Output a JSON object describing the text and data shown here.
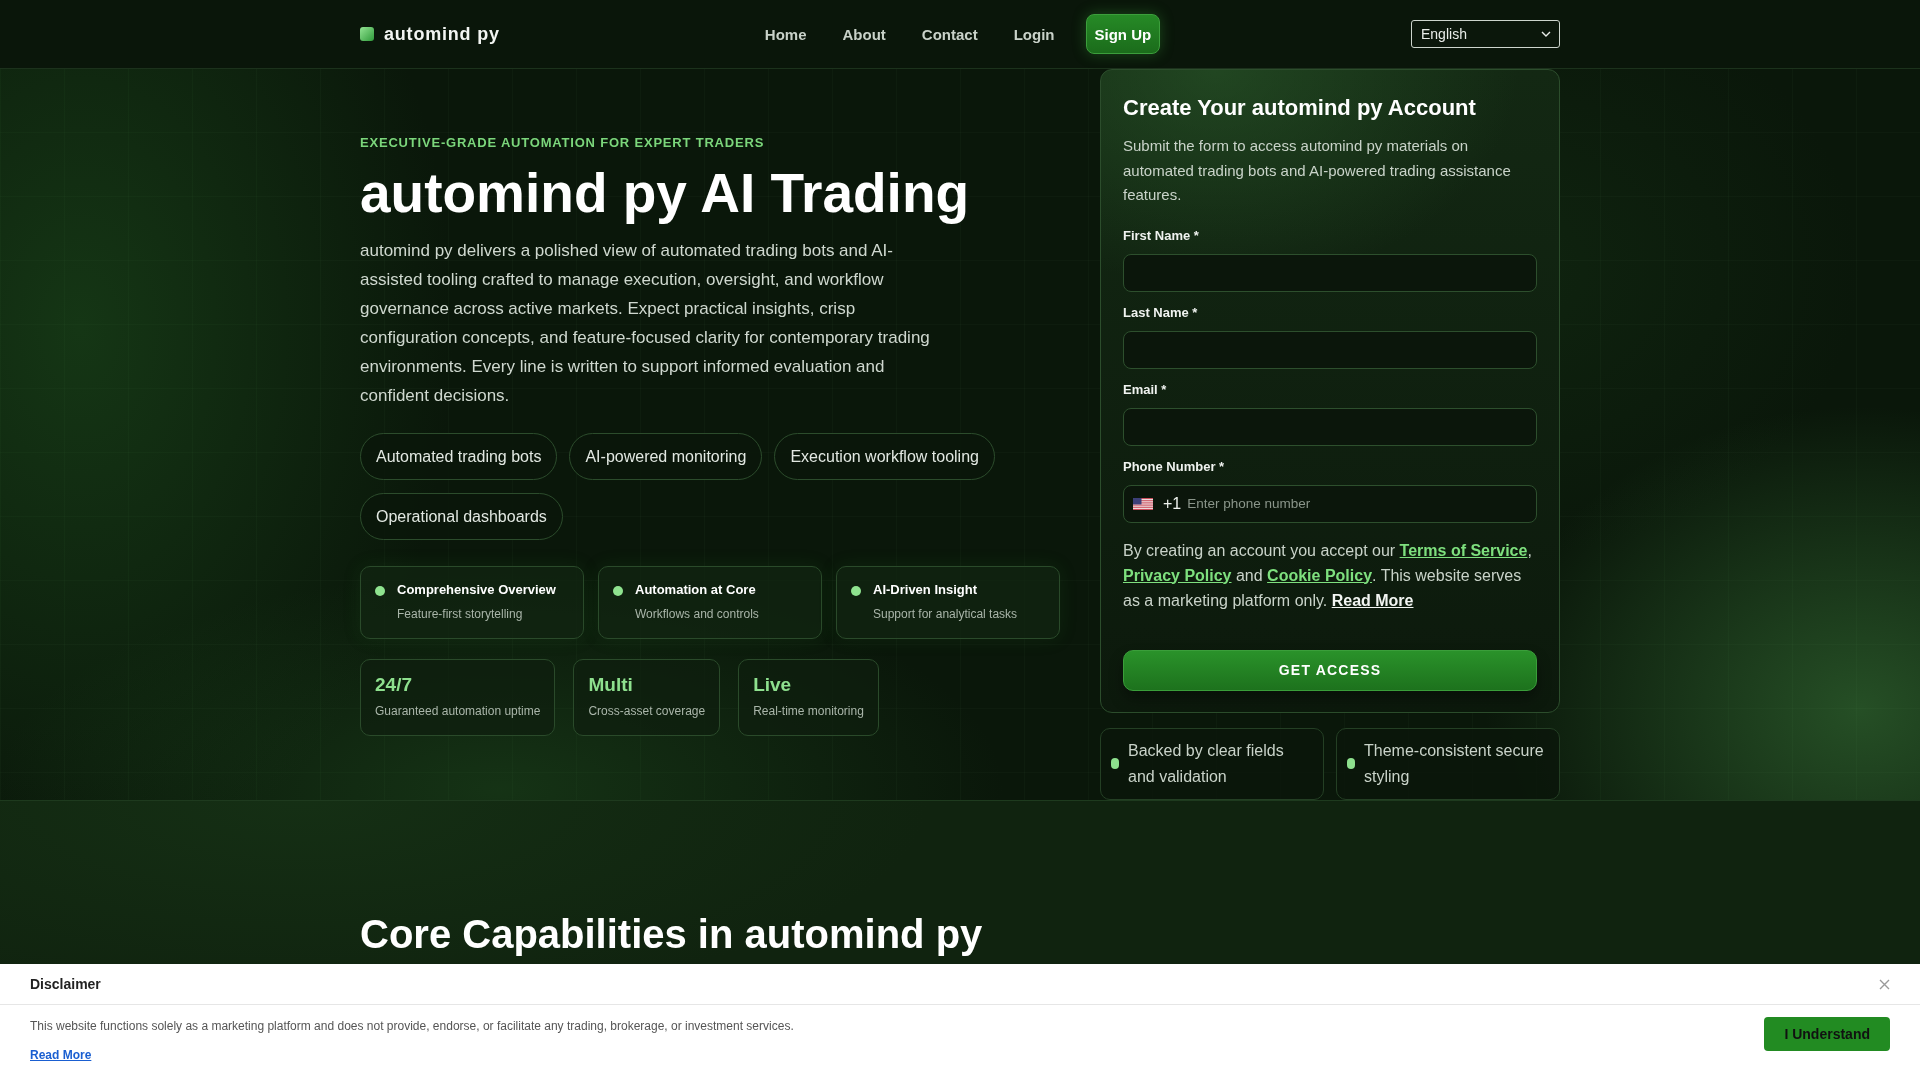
{
  "header": {
    "logo": "automind py",
    "nav": [
      {
        "label": "Home"
      },
      {
        "label": "About"
      },
      {
        "label": "Contact"
      },
      {
        "label": "Login"
      }
    ],
    "signup": "Sign Up",
    "language": "English"
  },
  "hero": {
    "eyebrow": "EXECUTIVE-GRADE AUTOMATION FOR EXPERT TRADERS",
    "title": "automind py AI Trading",
    "description": "automind py delivers a polished view of automated trading bots and AI-assisted tooling crafted to manage execution, oversight, and workflow governance across active markets. Expect practical insights, crisp configuration concepts, and feature-focused clarity for contemporary trading environments. Every line is written to support informed evaluation and confident decisions.",
    "tags": [
      "Automated trading bots",
      "AI-powered monitoring",
      "Execution workflow tooling",
      "Operational dashboards"
    ],
    "features": [
      {
        "title": "Comprehensive Overview",
        "subtitle": "Feature-first storytelling"
      },
      {
        "title": "Automation at Core",
        "subtitle": "Workflows and controls"
      },
      {
        "title": "AI-Driven Insight",
        "subtitle": "Support for analytical tasks"
      }
    ],
    "stats": [
      {
        "value": "24/7",
        "label": "Guaranteed automation uptime"
      },
      {
        "value": "Multi",
        "label": "Cross-asset coverage"
      },
      {
        "value": "Live",
        "label": "Real-time monitoring"
      }
    ]
  },
  "signup_form": {
    "title": "Create Your automind py Account",
    "description": "Submit the form to access automind py materials on automated trading bots and AI-powered trading assistance features.",
    "fields": [
      {
        "kind": "text",
        "label": "First Name *"
      },
      {
        "kind": "text",
        "label": "Last Name *"
      },
      {
        "kind": "text",
        "label": "Email *"
      },
      {
        "kind": "phone",
        "label": "Phone Number *",
        "dial_code": "+1",
        "placeholder": "Enter phone number"
      }
    ],
    "consent": [
      {
        "kind": "text",
        "text": "By creating an account you accept our "
      },
      {
        "kind": "link",
        "text": "Terms of Service"
      },
      {
        "kind": "text",
        "text": ", "
      },
      {
        "kind": "link",
        "text": "Privacy Policy"
      },
      {
        "kind": "text",
        "text": " and "
      },
      {
        "kind": "link",
        "text": "Cookie Policy"
      },
      {
        "kind": "text",
        "text": ". This website serves as a marketing platform only. "
      },
      {
        "kind": "more",
        "text": "Read More"
      }
    ],
    "submit": "GET ACCESS"
  },
  "form_badges": [
    "Backed by clear fields and validation",
    "Theme-consistent secure styling"
  ],
  "capabilities": {
    "title": "Core Capabilities in automind py"
  },
  "disclaimer": {
    "title": "Disclaimer",
    "text": "This website functions solely as a marketing platform and does not provide, endorse, or facilitate any trading, brokerage, or investment services.",
    "link": "Read More",
    "button": "I Understand"
  }
}
